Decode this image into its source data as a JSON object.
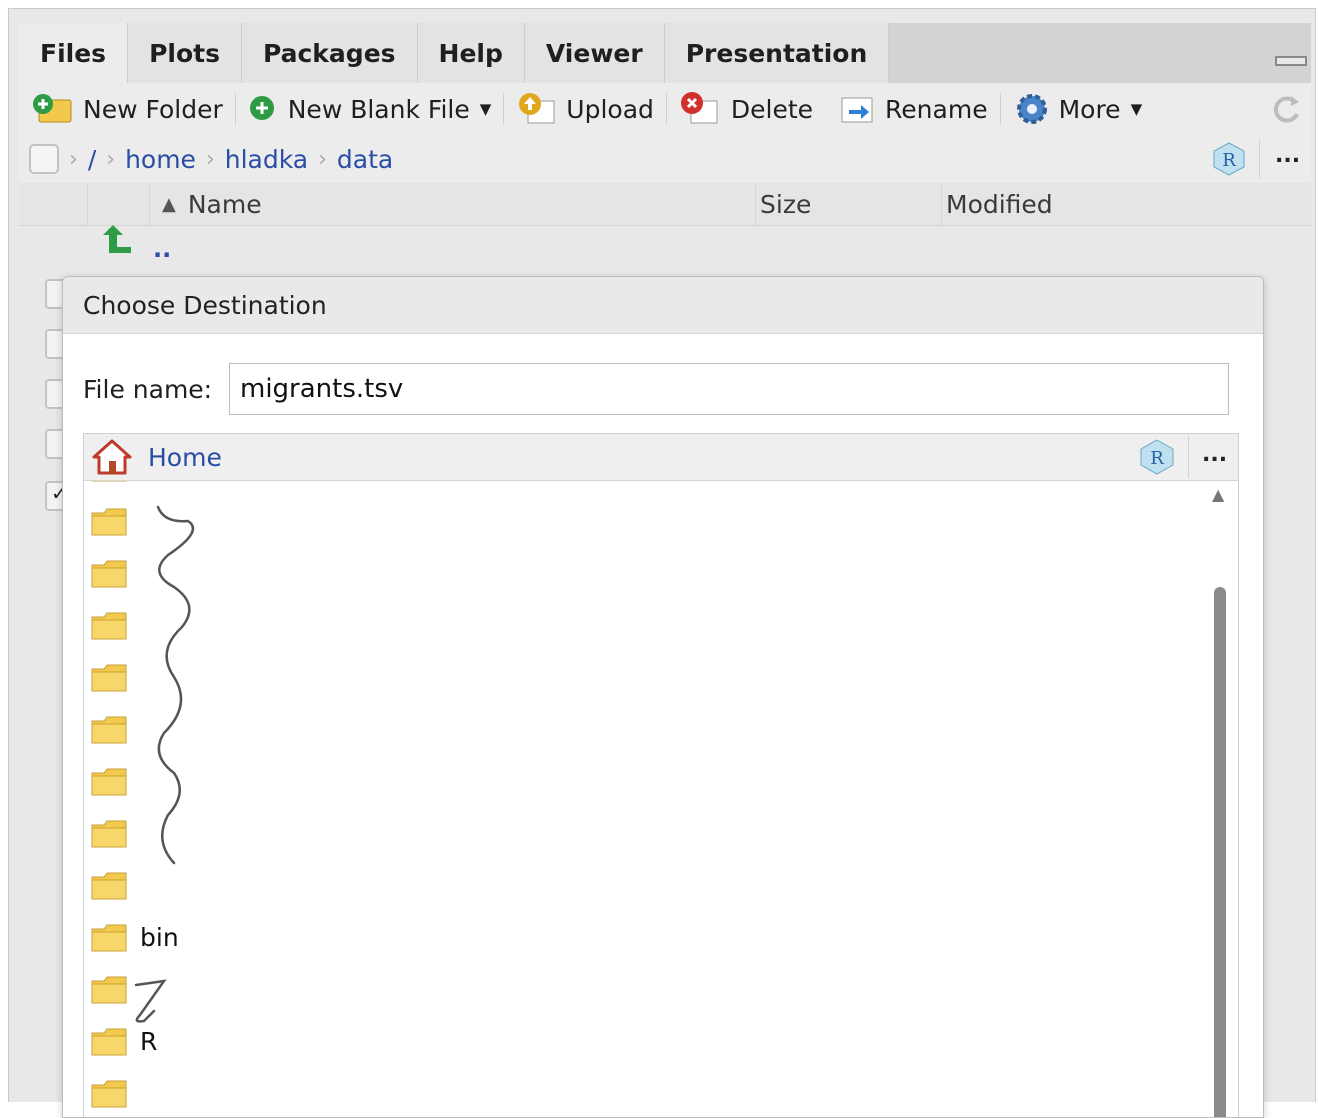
{
  "tabs": [
    {
      "label": "Files",
      "active": true
    },
    {
      "label": "Plots"
    },
    {
      "label": "Packages"
    },
    {
      "label": "Help"
    },
    {
      "label": "Viewer"
    },
    {
      "label": "Presentation"
    }
  ],
  "toolbar": {
    "new_folder": "New Folder",
    "new_blank_file": "New Blank File",
    "upload": "Upload",
    "delete": "Delete",
    "rename": "Rename",
    "more": "More"
  },
  "breadcrumb": {
    "root": "/",
    "items": [
      "home",
      "hladka",
      "data"
    ]
  },
  "columns": {
    "name": "Name",
    "size": "Size",
    "modified": "Modified"
  },
  "parent_dir": "..",
  "more_dots": "...",
  "dialog": {
    "title": "Choose Destination",
    "file_name_label": "File name:",
    "file_name_value": "migrants.tsv",
    "location": "Home",
    "folders": [
      "",
      "",
      "",
      "",
      "",
      "",
      "",
      "",
      "bin",
      "",
      "R",
      ""
    ]
  },
  "colors": {
    "link": "#2a4ea6",
    "folder": "#f2c94c",
    "accent_green": "#2e9b45"
  }
}
